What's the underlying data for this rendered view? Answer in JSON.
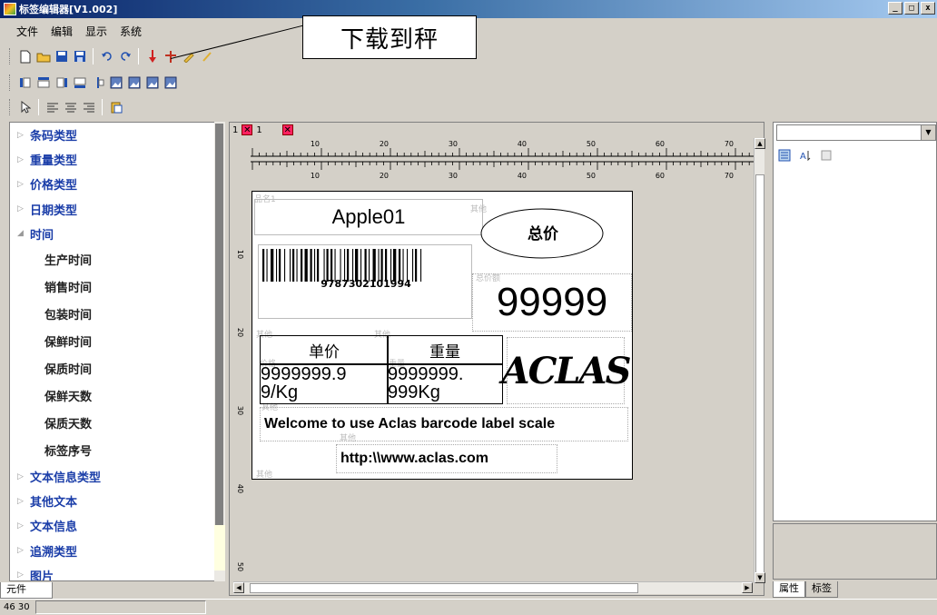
{
  "window": {
    "title": "标签编辑器[V1.002]",
    "minimize": "_",
    "maximize": "□",
    "close": "x"
  },
  "menu": [
    {
      "label": "文件"
    },
    {
      "label": "编辑"
    },
    {
      "label": "显示"
    },
    {
      "label": "系统"
    }
  ],
  "callout": {
    "text": "下载到秤"
  },
  "sidebar": {
    "items": [
      {
        "label": "条码类型",
        "type": "group"
      },
      {
        "label": "重量类型",
        "type": "group"
      },
      {
        "label": "价格类型",
        "type": "group"
      },
      {
        "label": "日期类型",
        "type": "group"
      },
      {
        "label": "时间",
        "type": "open"
      },
      {
        "label": "生产时间",
        "type": "sub"
      },
      {
        "label": "销售时间",
        "type": "sub"
      },
      {
        "label": "包装时间",
        "type": "sub"
      },
      {
        "label": "保鲜时间",
        "type": "sub"
      },
      {
        "label": "保质时间",
        "type": "sub"
      },
      {
        "label": "保鲜天数",
        "type": "sub"
      },
      {
        "label": "保质天数",
        "type": "sub"
      },
      {
        "label": "标签序号",
        "type": "sub"
      },
      {
        "label": "文本信息类型",
        "type": "group"
      },
      {
        "label": "其他文本",
        "type": "group"
      },
      {
        "label": "文本信息",
        "type": "group"
      },
      {
        "label": "追溯类型",
        "type": "group"
      },
      {
        "label": "图片",
        "type": "group"
      }
    ],
    "tab_label": "元件"
  },
  "canvas": {
    "tab_number_a": "1",
    "tab_number_b": "1",
    "ruler_labels": [
      "10",
      "20",
      "30",
      "40",
      "50",
      "60",
      "70"
    ],
    "vruler_labels": [
      "10",
      "20",
      "30",
      "40",
      "50"
    ]
  },
  "label": {
    "product_name": "Apple01",
    "total_price_title": "总价",
    "barcode_number": "9787302101994",
    "total_price_value": "99999",
    "unit_price_title": "单价",
    "weight_title": "重量",
    "unit_price_line1": "9999999.9",
    "unit_price_line2": "9/Kg",
    "weight_line1": "9999999.",
    "weight_line2": "999Kg",
    "logo": "ACLAS",
    "welcome": "Welcome to use Aclas barcode label scale",
    "url": "http:\\\\www.aclas.com",
    "ghost_labels": [
      "品名1",
      "其他",
      "总价额",
      "其他",
      "其他",
      "价格",
      "重量",
      "其他",
      "其他",
      "其他"
    ]
  },
  "right_panel": {
    "tabs": [
      "属性",
      "标签"
    ]
  },
  "status": {
    "coords": "46 30"
  },
  "colors": {
    "accent": "#1a3da8",
    "title_bar": "#0a246a",
    "marker": "#ff2060"
  }
}
